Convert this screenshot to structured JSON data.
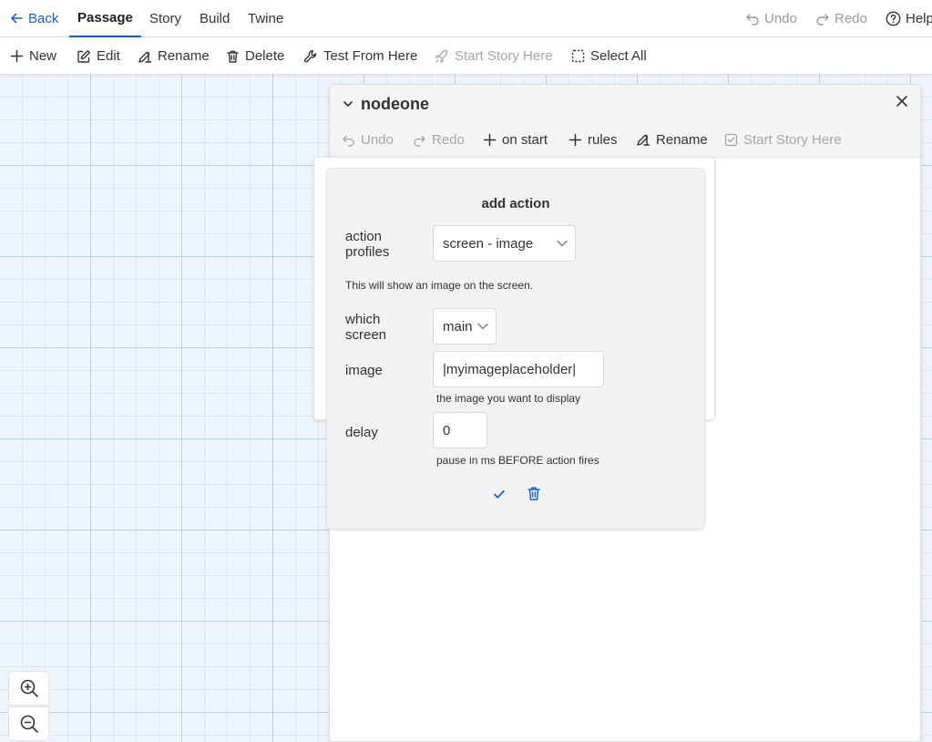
{
  "topnav": {
    "back": "Back",
    "tabs": [
      "Passage",
      "Story",
      "Build",
      "Twine"
    ],
    "undo": "Undo",
    "redo": "Redo",
    "help": "Help"
  },
  "toolbar": {
    "new": "New",
    "edit": "Edit",
    "rename": "Rename",
    "delete": "Delete",
    "test_from_here": "Test From Here",
    "start_story_here": "Start Story Here",
    "select_all": "Select All"
  },
  "dialog": {
    "title": "nodeone",
    "undo": "Undo",
    "redo": "Redo",
    "on_start": "on start",
    "rules": "rules",
    "rename": "Rename",
    "start_story_here": "Start Story Here"
  },
  "add_action": {
    "title": "add action",
    "action_profiles_label_1": "action",
    "action_profiles_label_2": "profiles",
    "action_profile_value": "screen - image",
    "profile_description": "This will show an image on the screen.",
    "which_screen_label_1": "which",
    "which_screen_label_2": "screen",
    "which_screen_value": "main",
    "image_label": "image",
    "image_value": "|myimageplaceholder|",
    "image_help": "the image you want to display",
    "delay_label": "delay",
    "delay_value": "0",
    "delay_help": "pause in ms BEFORE action fires"
  },
  "colors": {
    "accent": "#1a63c6",
    "disabled": "#a6a6a6",
    "grid_bg": "#eef4fc"
  }
}
